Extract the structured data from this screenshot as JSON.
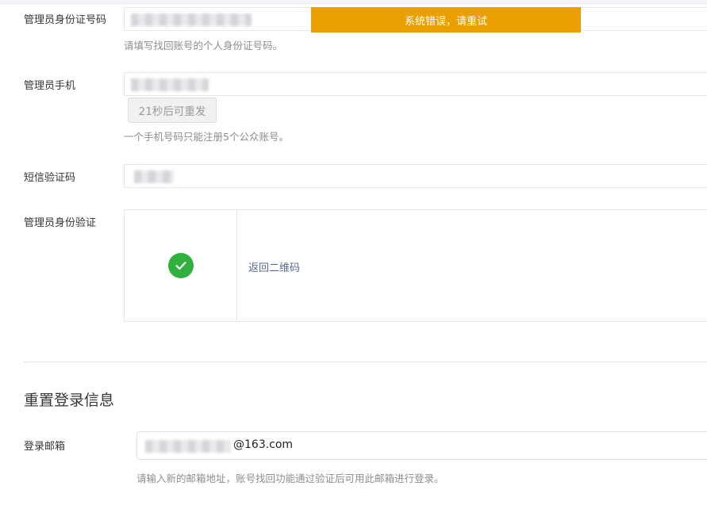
{
  "form": {
    "id_label": "管理员身份证号码",
    "id_hint": "请填写找回账号的个人身份证号码。",
    "phone_label": "管理员手机",
    "resend_label": "21秒后可重发",
    "phone_hint": "一个手机号码只能注册5个公众账号。",
    "sms_label": "短信验证码",
    "verify_label": "管理员身份验证",
    "qr_back_link": "返回二维码"
  },
  "toast": {
    "message": "系统错误，请重试"
  },
  "reset": {
    "section_title": "重置登录信息",
    "email_label": "登录邮箱",
    "email_suffix": "@163.com",
    "email_hint": "请输入新的邮箱地址，账号找回功能通过验证后可用此邮箱进行登录。"
  },
  "colors": {
    "toast_bg": "#eaa000",
    "success": "#31b03d",
    "link": "#576b95"
  },
  "icons": {
    "verified": "check-circle-icon"
  }
}
